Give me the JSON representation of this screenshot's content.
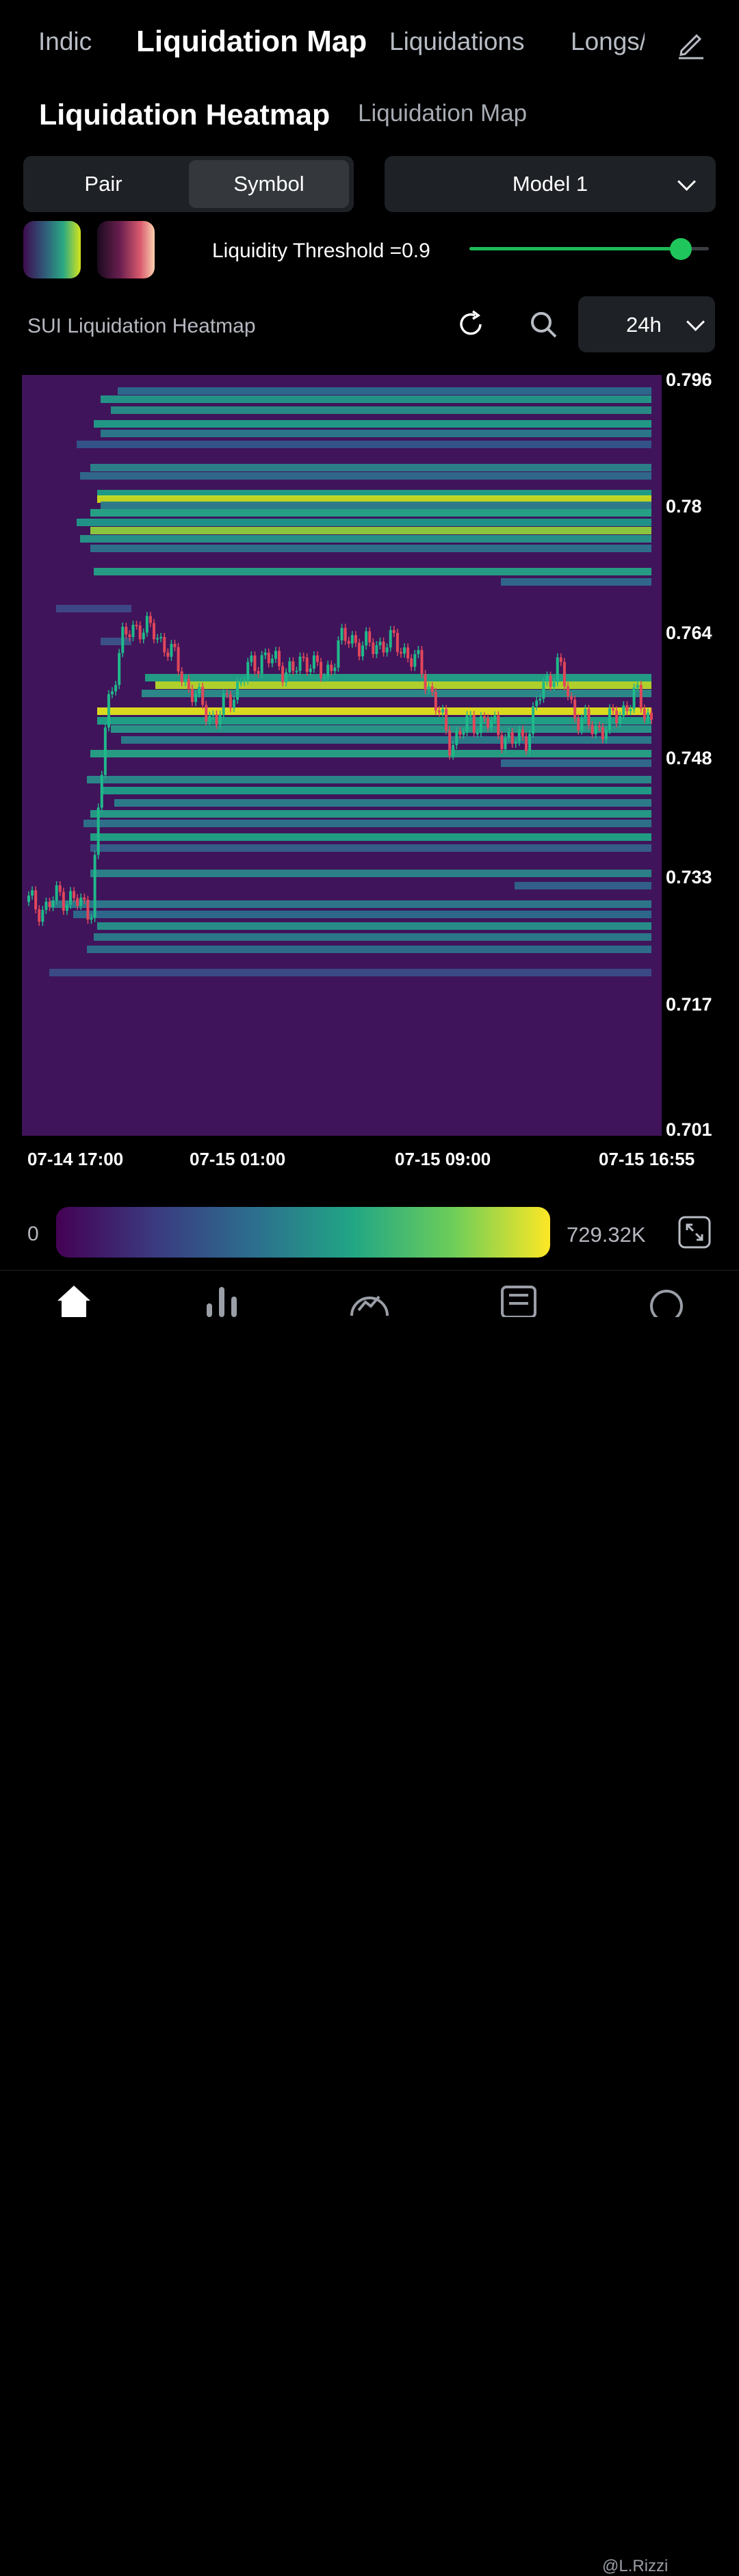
{
  "top_tabs": [
    "Indic",
    "Liquidation Map",
    "Liquidations",
    "Longs/"
  ],
  "sub_tabs": [
    "Liquidation Heatmap",
    "Liquidation Map"
  ],
  "segmented": {
    "left": "Pair",
    "right": "Symbol",
    "selected": "Symbol"
  },
  "model_select": {
    "value": "Model 1"
  },
  "threshold_label": "Liquidity Threshold =0.9",
  "threshold_value": 0.9,
  "chart_header": {
    "title": "SUI Liquidation Heatmap",
    "range": "24h"
  },
  "colors": {
    "accent": "#1db954",
    "background": "#000000",
    "panel": "#1e2125",
    "heat_bg": "#40145a",
    "up": "#1fb98a",
    "down": "#e0475a"
  },
  "icons": [
    "edit-icon",
    "refresh-icon",
    "search-icon",
    "chevron-down-icon",
    "expand-icon",
    "home-icon",
    "bar-chart-icon",
    "trend-icon",
    "news-icon",
    "profile-icon"
  ],
  "chart_data": {
    "type": "heatmap",
    "title": "SUI Liquidation Heatmap",
    "y_ticks": [
      "0.796",
      "0.78",
      "0.764",
      "0.748",
      "0.733",
      "0.717",
      "0.701"
    ],
    "x_ticks": [
      "07-14 17:00",
      "07-15 01:00",
      "07-15 09:00",
      "07-15 16:55"
    ],
    "ylim": [
      0.701,
      0.796
    ],
    "price_series": {
      "name": "",
      "points": [
        [
          0,
          0.73
        ],
        [
          0.02,
          0.729
        ],
        [
          0.04,
          0.731
        ],
        [
          0.06,
          0.73
        ],
        [
          0.08,
          0.729
        ],
        [
          0.1,
          0.754
        ],
        [
          0.12,
          0.763
        ],
        [
          0.14,
          0.765
        ],
        [
          0.16,
          0.764
        ],
        [
          0.18,
          0.762
        ],
        [
          0.2,
          0.758
        ],
        [
          0.22,
          0.755
        ],
        [
          0.24,
          0.753
        ],
        [
          0.26,
          0.756
        ],
        [
          0.28,
          0.759
        ],
        [
          0.3,
          0.761
        ],
        [
          0.32,
          0.76
        ],
        [
          0.34,
          0.759
        ],
        [
          0.36,
          0.761
        ],
        [
          0.38,
          0.758
        ],
        [
          0.4,
          0.763
        ],
        [
          0.42,
          0.763
        ],
        [
          0.44,
          0.762
        ],
        [
          0.46,
          0.763
        ],
        [
          0.48,
          0.762
        ],
        [
          0.5,
          0.76
        ],
        [
          0.52,
          0.756
        ],
        [
          0.54,
          0.75
        ],
        [
          0.56,
          0.752
        ],
        [
          0.58,
          0.753
        ],
        [
          0.6,
          0.752
        ],
        [
          0.62,
          0.75
        ],
        [
          0.64,
          0.751
        ],
        [
          0.66,
          0.757
        ],
        [
          0.68,
          0.76
        ],
        [
          0.7,
          0.754
        ],
        [
          0.72,
          0.752
        ],
        [
          0.74,
          0.752
        ],
        [
          0.76,
          0.754
        ],
        [
          0.78,
          0.756
        ],
        [
          0.8,
          0.753
        ]
      ]
    },
    "legend_min": "0",
    "legend_max": "729.32K",
    "colorscale": [
      "#440154",
      "#3b3a80",
      "#2c6e8e",
      "#21a685",
      "#6bcd5a",
      "#fde725"
    ]
  },
  "watermark": "@L.Rizzi"
}
